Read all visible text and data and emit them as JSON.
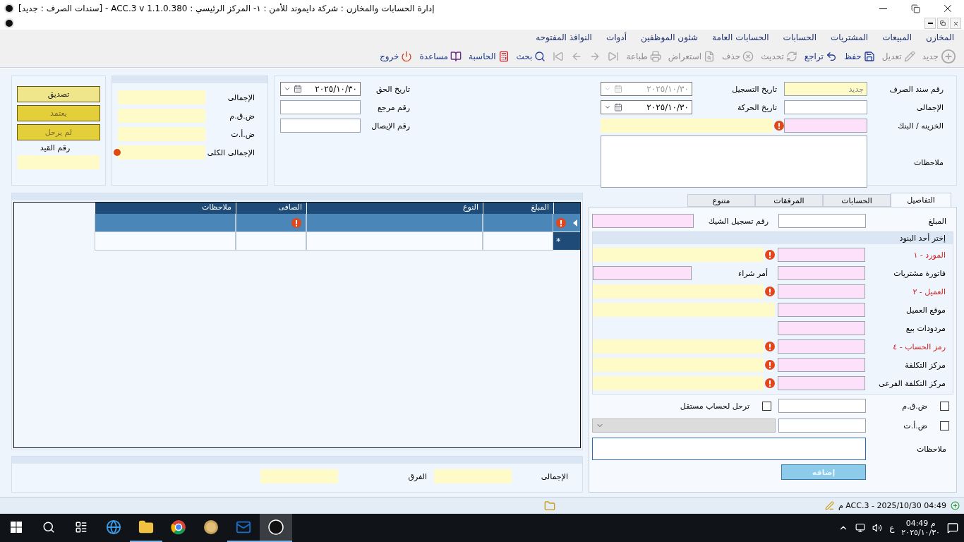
{
  "window": {
    "title": "إدارة الحسابات والمخازن : شركة دايموند للأمن : ١- المركز الرئيسي : ACC.3 v 1.1.0.380 - [سندات الصرف : جديد]"
  },
  "menu": [
    "المخازن",
    "المبيعات",
    "المشتريات",
    "الحسابات",
    "الحسابات العامة",
    "شئون الموظفين",
    "أدوات",
    "النوافذ المفتوحه"
  ],
  "toolbar": [
    {
      "kind": "button",
      "label": "جديد",
      "disabled": true
    },
    {
      "kind": "button",
      "label": "تعديل",
      "disabled": true
    },
    {
      "kind": "button",
      "label": "حفظ",
      "disabled": false
    },
    {
      "kind": "button",
      "label": "تراجع",
      "disabled": false
    },
    {
      "kind": "button",
      "label": "تحديث",
      "disabled": true
    },
    {
      "kind": "button",
      "label": "حذف",
      "disabled": true
    },
    {
      "kind": "button",
      "label": "استعراض",
      "disabled": true
    },
    {
      "kind": "button",
      "label": "طباعة",
      "disabled": true
    },
    {
      "kind": "nav",
      "disabled": true
    },
    {
      "kind": "nav",
      "disabled": true
    },
    {
      "kind": "nav",
      "disabled": true
    },
    {
      "kind": "nav",
      "disabled": true
    },
    {
      "kind": "button",
      "label": "بحث",
      "disabled": false
    },
    {
      "kind": "button",
      "label": "الحاسبة",
      "disabled": false
    },
    {
      "kind": "button",
      "label": "مساعدة",
      "disabled": false
    },
    {
      "kind": "button",
      "label": "خروج",
      "disabled": false
    }
  ],
  "header": {
    "number": {
      "label": "رقم سند الصرف",
      "value": "جديد"
    },
    "registration_date": {
      "label": "تاريخ التسجيل",
      "value": "٢٠٢٥/١٠/٣٠",
      "disabled": true
    },
    "total": {
      "label": "الإجمالى"
    },
    "movement_date": {
      "label": "تاريخ الحركة",
      "value": "٢٠٢٥/١٠/٣٠",
      "disabled": false
    },
    "treasury": {
      "label": "الخزينه / البنك",
      "required": true
    },
    "notes": {
      "label": "ملاحظات"
    },
    "due_date": {
      "label": "تاريخ الحق",
      "value": "٢٠٢٥/١٠/٣٠",
      "disabled": false
    },
    "reference": {
      "label": "رقم مرجع"
    },
    "receipt": {
      "label": "رقم الإيصال"
    }
  },
  "summary": [
    {
      "label": "الإجمالى",
      "warning": false
    },
    {
      "label": "ض.ق.م",
      "warning": false
    },
    {
      "label": "ض.أ.ت",
      "warning": false
    },
    {
      "label": "الإجمالى الكلى",
      "warning": true
    }
  ],
  "approval": {
    "buttons": [
      {
        "label": "تصديق",
        "active": true
      },
      {
        "label": "يعتمد",
        "active": false
      },
      {
        "label": "لم يرحل",
        "active": false
      }
    ],
    "entry_label": "رقم القيد"
  },
  "tabs": [
    {
      "label": "التفاصيل",
      "selected": true
    },
    {
      "label": "الحسابات",
      "selected": false
    },
    {
      "label": "المرفقات",
      "selected": false
    },
    {
      "label": "متنوع",
      "selected": false
    }
  ],
  "details": {
    "amount_label": "المبلغ",
    "cheque_label": "رقم تسجيل الشيك",
    "group_title": "إختر أحد البنود",
    "items": [
      {
        "kind": "lookup",
        "label": "المورد - ١",
        "color": "#d42020",
        "required": true
      },
      {
        "kind": "pair",
        "label": "فاتورة مشتريات",
        "second_label": "أمر شراء",
        "color": "#000000"
      },
      {
        "kind": "lookup",
        "label": "العميل - ٢",
        "color": "#d42020",
        "required": true
      },
      {
        "kind": "lookup",
        "label": "موقع العميل",
        "color": "#000000",
        "required": false
      },
      {
        "kind": "single",
        "label": "مردودات بيع",
        "color": "#000000"
      },
      {
        "kind": "lookup",
        "label": "رمز الحساب - ٤",
        "color": "#d42020",
        "required": true
      },
      {
        "kind": "lookup",
        "label": "مركز التكلفة",
        "color": "#000000",
        "required": true
      },
      {
        "kind": "lookup",
        "label": "مركز التكلفة الفرعى",
        "color": "#000000",
        "required": true
      }
    ],
    "taxes": [
      {
        "kind": "option",
        "label": "ض.ق.م",
        "checked": false,
        "option_label": "ترحل لحساب مستقل",
        "option_checked": false
      },
      {
        "kind": "select",
        "label": "ض.أ.ت",
        "checked": false
      }
    ],
    "notes_label": "ملاحظات",
    "add_button": {
      "label": "إضافه",
      "disabled": true
    }
  },
  "grid": {
    "columns": [
      "المبلغ",
      "النوع",
      "الصافى",
      "ملاحظات"
    ],
    "rows": [
      {
        "kind": "current",
        "selected": true,
        "error": true
      },
      {
        "kind": "new",
        "selected": false,
        "marker": "*",
        "error": false
      }
    ]
  },
  "totals": {
    "total_label": "الإجمالى",
    "difference_label": "الفرق"
  },
  "status_bar": {
    "text": "ACC.3 - 2025/10/30 04:49 م"
  },
  "taskbar": {
    "apps": [
      {
        "running": false,
        "selected": false
      },
      {
        "running": true,
        "selected": false
      },
      {
        "running": false,
        "selected": false
      },
      {
        "running": false,
        "selected": false
      },
      {
        "running": true,
        "selected": false
      },
      {
        "running": true,
        "selected": true
      }
    ],
    "language": "ع",
    "time": "04:49 م",
    "date": "٢٠٢٥/١٠/٣٠"
  }
}
